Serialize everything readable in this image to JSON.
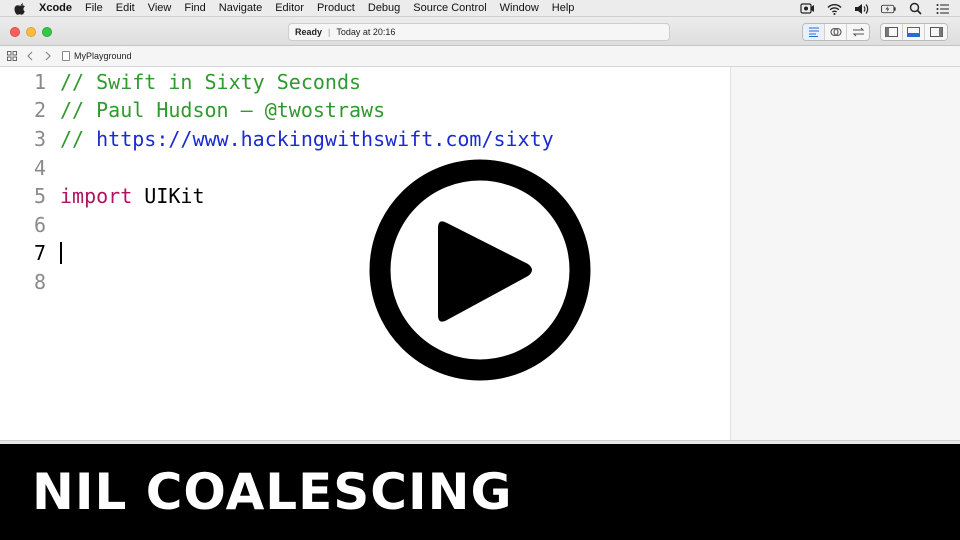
{
  "menubar": {
    "app_name": "Xcode",
    "items": [
      "File",
      "Edit",
      "View",
      "Find",
      "Navigate",
      "Editor",
      "Product",
      "Debug",
      "Source Control",
      "Window",
      "Help"
    ],
    "status_icons": [
      "screen-record-icon",
      "wifi-icon",
      "volume-icon",
      "battery-icon",
      "spotlight-search-icon",
      "notification-center-icon"
    ]
  },
  "toolbar": {
    "activity_status": "Ready",
    "activity_time": "Today at 20:16",
    "editor_mode_icons": [
      "standard-editor-icon",
      "assistant-editor-icon",
      "version-editor-icon"
    ],
    "panel_icons": [
      "navigator-toggle-icon",
      "debug-area-toggle-icon",
      "utilities-toggle-icon"
    ]
  },
  "jumpbar": {
    "file_name": "MyPlayground"
  },
  "editor": {
    "lines": [
      {
        "num": "1",
        "text": "// Swift in Sixty Seconds"
      },
      {
        "num": "2",
        "text": "// Paul Hudson — @twostraws"
      },
      {
        "num": "3",
        "prefix": "// ",
        "url": "https://www.hackingwithswift.com/sixty"
      },
      {
        "num": "4",
        "text": ""
      },
      {
        "num": "5",
        "keyword": "import",
        "rest": " UIKit"
      },
      {
        "num": "6",
        "text": ""
      },
      {
        "num": "7",
        "text": ""
      },
      {
        "num": "8",
        "text": ""
      }
    ],
    "current_line": "7"
  },
  "overlay": {
    "play_icon": "play-circle-icon"
  },
  "banner": {
    "title": "NIL COALESCING"
  }
}
